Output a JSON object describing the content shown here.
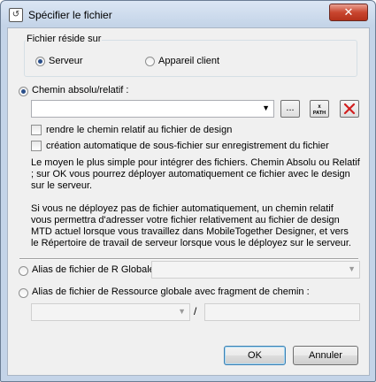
{
  "window": {
    "title": "Spécifier le fichier",
    "close_glyph": "✕"
  },
  "location_group": {
    "label": "Fichier réside sur",
    "options": [
      {
        "label": "Serveur",
        "selected": true
      },
      {
        "label": "Appareil client",
        "selected": false
      }
    ]
  },
  "path_section": {
    "radio_label": "Chemin absolu/relatif :",
    "selected": true,
    "path_value": "",
    "browse_label": "...",
    "checkbox_relative": {
      "label": "rendre le chemin relatif au fichier de design",
      "checked": false
    },
    "checkbox_subfolder": {
      "label": "création automatique de sous-fichier sur enregistrement du fichier",
      "checked": false
    },
    "info_text_1": "Le moyen le plus simple pour intégrer des fichiers. Chemin Absolu ou Relatif ; sur OK vous pourrez déployer automatiquement ce fichier avec le design sur le serveur.",
    "info_text_2": "Si vous ne déployez pas de fichier automatiquement, un chemin relatif vous permettra d'adresser votre fichier relativement au fichier de design MTD actuel lorsque vous travaillez dans MobileTogether Designer, et vers le Répertoire de travail de serveur lorsque vous le déployez sur le serveur."
  },
  "global_alias": {
    "label": "Alias de fichier de R Globale",
    "selected": false,
    "value": ""
  },
  "global_folder": {
    "label": "Alias de fichier de Ressource globale avec fragment de chemin :",
    "selected": false,
    "alias_value": "",
    "separator": "/",
    "fragment_value": ""
  },
  "buttons": {
    "ok": "OK",
    "cancel": "Annuler"
  },
  "colors": {
    "accent": "#2a4f8a",
    "close_red": "#c9462f",
    "delete_red": "#d21f1f"
  }
}
